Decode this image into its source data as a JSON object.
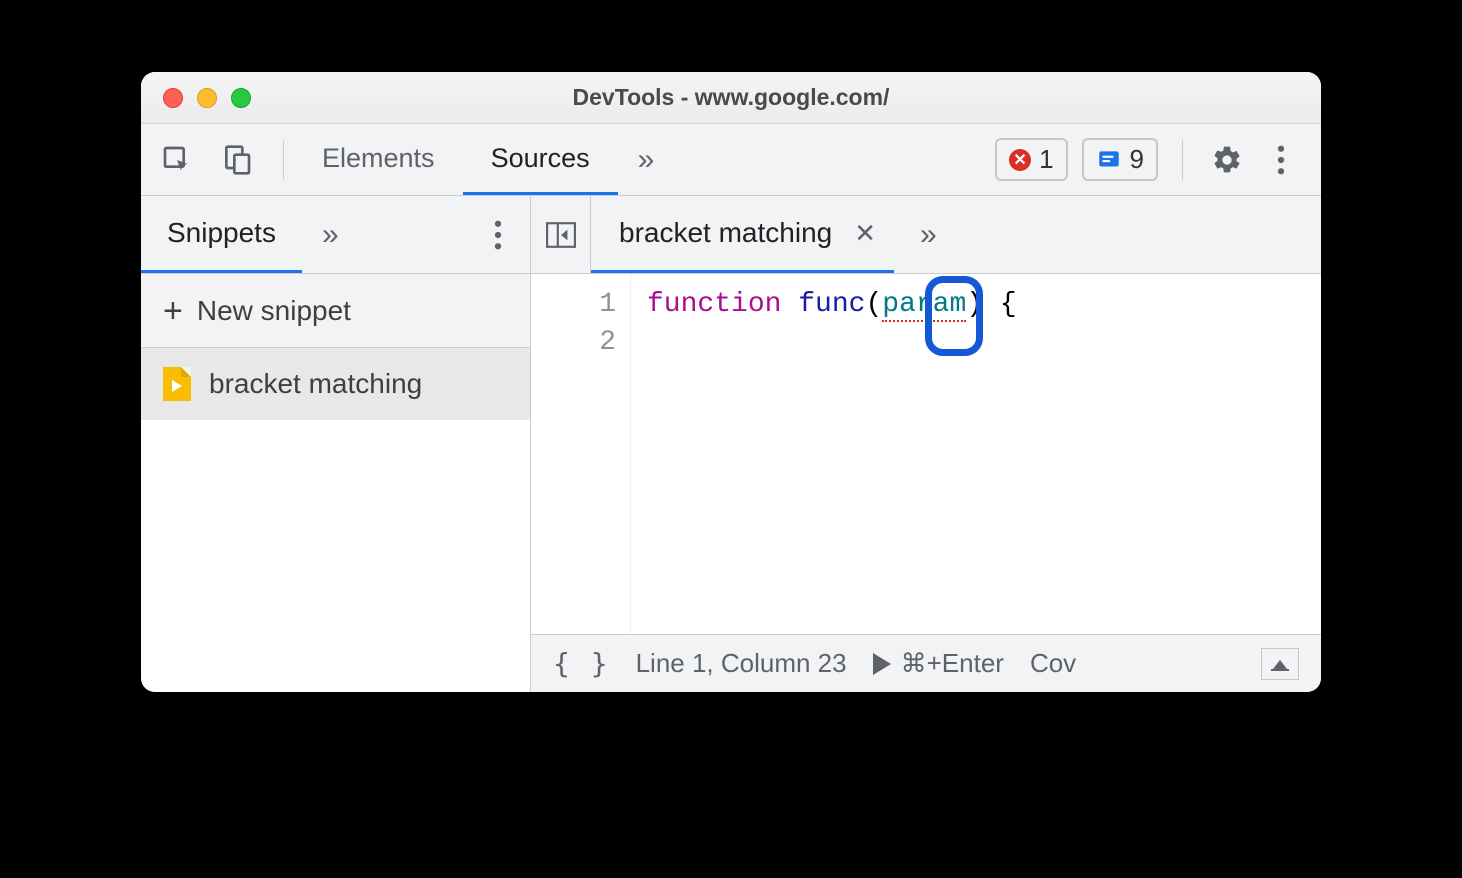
{
  "window": {
    "title": "DevTools - www.google.com/"
  },
  "toolbar": {
    "tabs": [
      {
        "label": "Elements",
        "active": false
      },
      {
        "label": "Sources",
        "active": true
      }
    ],
    "errors_count": "1",
    "issues_count": "9"
  },
  "sidebar": {
    "tab_label": "Snippets",
    "new_snippet_label": "New snippet",
    "items": [
      {
        "label": "bracket matching",
        "selected": true
      }
    ]
  },
  "editor": {
    "tab_label": "bracket matching",
    "lines": {
      "1": "1",
      "2": "2"
    },
    "code": {
      "keyword": "function",
      "space1": " ",
      "func": "func",
      "lparen": "(",
      "param": "param",
      "rparen": ")",
      "space2": " ",
      "brace": "{"
    }
  },
  "status": {
    "braces_icon": "{ }",
    "position": "Line 1, Column 23",
    "run_shortcut": "⌘+Enter",
    "coverage_label": "Cov"
  }
}
